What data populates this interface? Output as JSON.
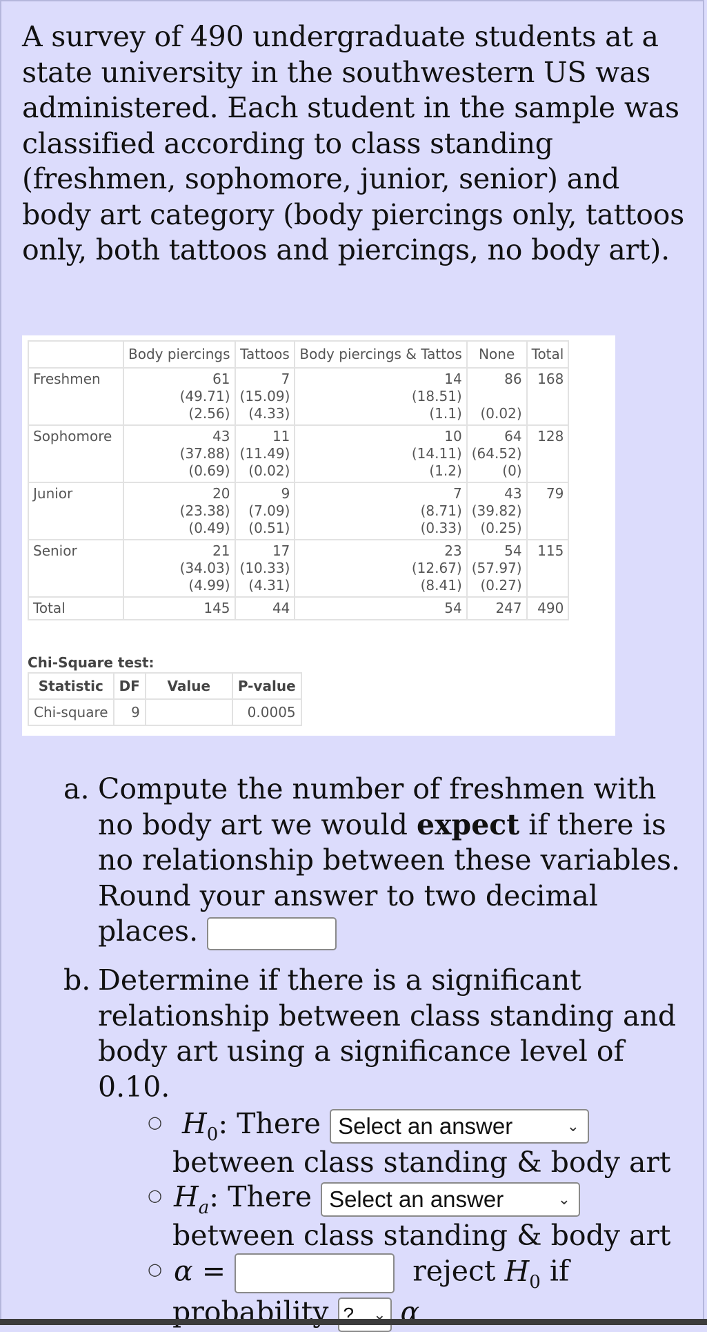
{
  "intro": "A survey of 490 undergraduate students at a state university in the southwestern US was administered. Each student in the sample was classified according to class standing (freshmen, sophomore, junior, senior) and body art category (body piercings only, tattoos only, both tattoos and piercings, no body art).",
  "contingency_table": {
    "headers": [
      "",
      "Body piercings",
      "Tattoos",
      "Body piercings & Tattos",
      "None",
      "Total"
    ],
    "rows": [
      {
        "label": "Freshmen",
        "cells": [
          {
            "observed": "61",
            "expected": "(49.71)",
            "contrib": "(2.56)"
          },
          {
            "observed": "7",
            "expected": "(15.09)",
            "contrib": "(4.33)"
          },
          {
            "observed": "14",
            "expected": "(18.51)",
            "contrib": "(1.1)"
          },
          {
            "observed": "86",
            "expected": "",
            "contrib": "(0.02)"
          }
        ],
        "total": "168"
      },
      {
        "label": "Sophomore",
        "cells": [
          {
            "observed": "43",
            "expected": "(37.88)",
            "contrib": "(0.69)"
          },
          {
            "observed": "11",
            "expected": "(11.49)",
            "contrib": "(0.02)"
          },
          {
            "observed": "10",
            "expected": "(14.11)",
            "contrib": "(1.2)"
          },
          {
            "observed": "64",
            "expected": "(64.52)",
            "contrib": "(0)"
          }
        ],
        "total": "128"
      },
      {
        "label": "Junior",
        "cells": [
          {
            "observed": "20",
            "expected": "(23.38)",
            "contrib": "(0.49)"
          },
          {
            "observed": "9",
            "expected": "(7.09)",
            "contrib": "(0.51)"
          },
          {
            "observed": "7",
            "expected": "(8.71)",
            "contrib": "(0.33)"
          },
          {
            "observed": "43",
            "expected": "(39.82)",
            "contrib": "(0.25)"
          }
        ],
        "total": "79"
      },
      {
        "label": "Senior",
        "cells": [
          {
            "observed": "21",
            "expected": "(34.03)",
            "contrib": "(4.99)"
          },
          {
            "observed": "17",
            "expected": "(10.33)",
            "contrib": "(4.31)"
          },
          {
            "observed": "23",
            "expected": "(12.67)",
            "contrib": "(8.41)"
          },
          {
            "observed": "54",
            "expected": "(57.97)",
            "contrib": "(0.27)"
          }
        ],
        "total": "115"
      }
    ],
    "totals": {
      "label": "Total",
      "values": [
        "145",
        "44",
        "54",
        "247"
      ],
      "grand": "490"
    }
  },
  "chi_square": {
    "title": "Chi-Square test:",
    "headers": [
      "Statistic",
      "DF",
      "Value",
      "P-value"
    ],
    "row": [
      "Chi-square",
      "9",
      "",
      "0.0005"
    ]
  },
  "question_a": {
    "marker": "a.",
    "text_1": "Compute the number of freshmen with no body art we would ",
    "bold": "expect",
    "text_2": " if there is no relationship between these variables. Round your answer to two decimal places.",
    "answer_value": ""
  },
  "question_b": {
    "marker": "b.",
    "text": "Determine if there is a significant relationship between class standing and body art using a significance level of 0.10.",
    "h0": {
      "symbol": "H",
      "sub": "0",
      "lead": ": There",
      "select_value": "Select an answer",
      "tail": "between class standing & body art"
    },
    "ha": {
      "symbol": "H",
      "sub": "a",
      "lead": ": There",
      "select_value": "Select an answer",
      "tail": "between class standing & body art"
    },
    "alpha": {
      "symbol": "α",
      "eq": " =",
      "value": "",
      "reject_text": "reject ",
      "reject_sym": "H",
      "reject_sub": "0",
      "reject_tail": " if"
    },
    "probability": {
      "label": "probability",
      "select_value": "?",
      "tail_sym": "α"
    }
  },
  "icons": {
    "chevron": "⌄",
    "bullet": "○"
  }
}
